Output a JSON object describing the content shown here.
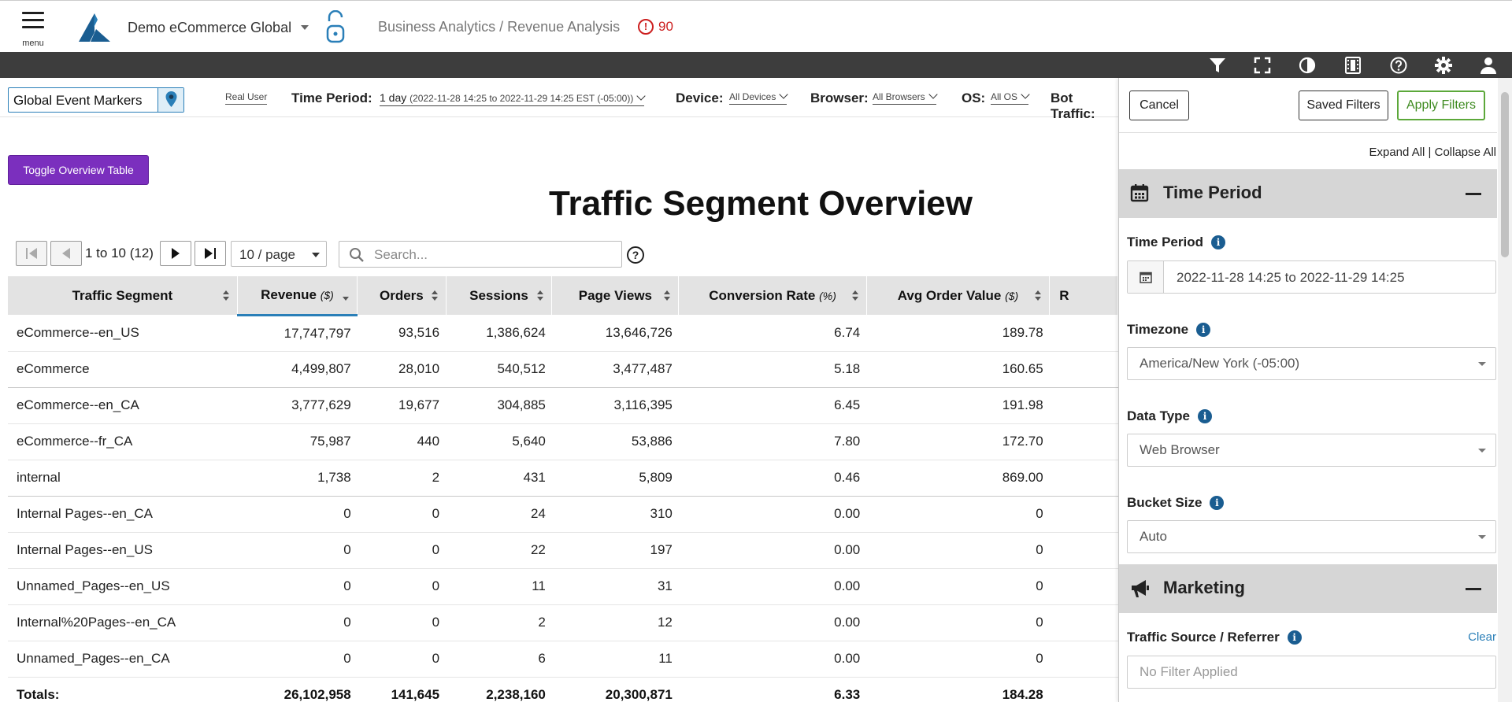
{
  "header": {
    "menu_label": "menu",
    "app_name": "Demo eCommerce Global",
    "breadcrumb": "Business Analytics / Revenue Analysis",
    "alert_count": "90",
    "alert_symbol": "!"
  },
  "filterbar": {
    "event_markers": "Global Event Markers",
    "real_user": "Real User",
    "time_period_label": "Time Period:",
    "time_period_value": "1 day",
    "time_period_range": "(2022-11-28 14:25 to 2022-11-29 14:25 EST (-05:00))",
    "device_label": "Device:",
    "device_value": "All Devices",
    "browser_label": "Browser:",
    "browser_value": "All Browsers",
    "os_label": "OS:",
    "os_value": "All OS",
    "bot_label": "Bot Traffic:"
  },
  "main": {
    "toggle_button": "Toggle Overview Table",
    "title": "Traffic Segment Overview",
    "pager_text": "1 to 10 (12)",
    "page_size": "10 / page",
    "search_placeholder": "Search...",
    "help_symbol": "?"
  },
  "table": {
    "columns": [
      {
        "name": "Traffic Segment",
        "unit": ""
      },
      {
        "name": "Revenue",
        "unit": "($)"
      },
      {
        "name": "Orders",
        "unit": ""
      },
      {
        "name": "Sessions",
        "unit": ""
      },
      {
        "name": "Page Views",
        "unit": ""
      },
      {
        "name": "Conversion Rate",
        "unit": "(%)"
      },
      {
        "name": "Avg Order Value",
        "unit": "($)"
      },
      {
        "name": "R",
        "unit": ""
      }
    ],
    "rows": [
      [
        "eCommerce--en_US",
        "17,747,797",
        "93,516",
        "1,386,624",
        "13,646,726",
        "6.74",
        "189.78"
      ],
      [
        "eCommerce",
        "4,499,807",
        "28,010",
        "540,512",
        "3,477,487",
        "5.18",
        "160.65"
      ],
      [
        "eCommerce--en_CA",
        "3,777,629",
        "19,677",
        "304,885",
        "3,116,395",
        "6.45",
        "191.98"
      ],
      [
        "eCommerce--fr_CA",
        "75,987",
        "440",
        "5,640",
        "53,886",
        "7.80",
        "172.70"
      ],
      [
        "internal",
        "1,738",
        "2",
        "431",
        "5,809",
        "0.46",
        "869.00"
      ],
      [
        "Internal Pages--en_CA",
        "0",
        "0",
        "24",
        "310",
        "0.00",
        "0"
      ],
      [
        "Internal Pages--en_US",
        "0",
        "0",
        "22",
        "197",
        "0.00",
        "0"
      ],
      [
        "Unnamed_Pages--en_US",
        "0",
        "0",
        "11",
        "31",
        "0.00",
        "0"
      ],
      [
        "Internal%20Pages--en_CA",
        "0",
        "0",
        "2",
        "12",
        "0.00",
        "0"
      ],
      [
        "Unnamed_Pages--en_CA",
        "0",
        "0",
        "6",
        "11",
        "0.00",
        "0"
      ]
    ],
    "totals": [
      "Totals:",
      "26,102,958",
      "141,645",
      "2,238,160",
      "20,300,871",
      "6.33",
      "184.28"
    ]
  },
  "panel": {
    "cancel": "Cancel",
    "saved_filters": "Saved Filters",
    "apply_filters": "Apply Filters",
    "expand_all": "Expand All",
    "separator": " | ",
    "collapse_all": "Collapse All",
    "time_section": "Time Period",
    "time_period_label": "Time Period",
    "time_period_value": "2022-11-28 14:25 to 2022-11-29 14:25",
    "timezone_label": "Timezone",
    "timezone_value": "America/New York (-05:00)",
    "data_type_label": "Data Type",
    "data_type_value": "Web Browser",
    "bucket_label": "Bucket Size",
    "bucket_value": "Auto",
    "marketing_section": "Marketing",
    "traffic_source_label": "Traffic Source / Referrer",
    "clear": "Clear",
    "traffic_source_value": "No Filter Applied",
    "info_symbol": "i"
  },
  "colors": {
    "toggle_button": "#7b2fbe",
    "toolbar": "#3d3d3d",
    "alert": "#cc1f1f",
    "accent": "#2a7fb8",
    "apply": "#5ca83a",
    "info": "#1a5d91"
  },
  "icons": [
    "menu-icon",
    "logo-icon",
    "lock-icon",
    "alert-icon",
    "filter-icon",
    "fullscreen-icon",
    "contrast-icon",
    "film-icon",
    "help-icon",
    "gear-icon",
    "user-icon",
    "pin-icon",
    "calendar-icon",
    "megaphone-icon",
    "search-icon"
  ]
}
